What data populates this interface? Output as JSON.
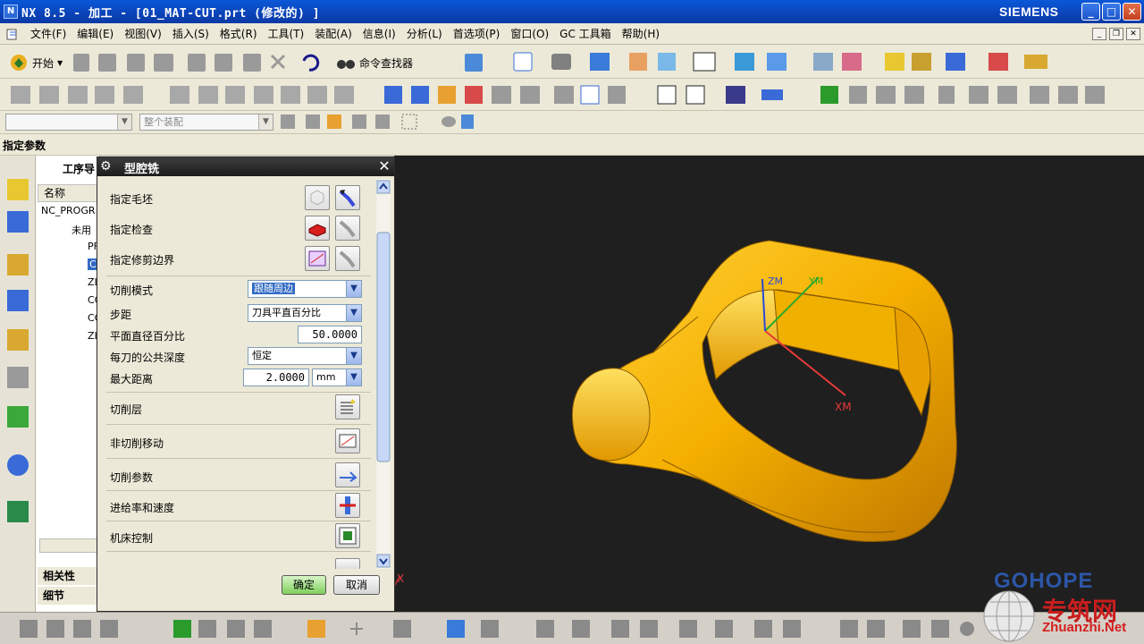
{
  "window": {
    "title": "NX 8.5 - 加工 - [01_MAT-CUT.prt  (修改的) ]",
    "brand": "SIEMENS",
    "min_btn": "_",
    "max_btn": "□",
    "close_btn": "✕"
  },
  "menu": {
    "items": [
      "文件(F)",
      "编辑(E)",
      "视图(V)",
      "插入(S)",
      "格式(R)",
      "工具(T)",
      "装配(A)",
      "信息(I)",
      "分析(L)",
      "首选项(P)",
      "窗口(O)",
      "GC 工具箱",
      "帮助(H)"
    ]
  },
  "toolbar": {
    "start_label": "开始",
    "command_finder_label": "命令查找器",
    "assembly_combo": "整个装配"
  },
  "context": {
    "label": "指定参数"
  },
  "navigator": {
    "title": "工序导",
    "column_name": "名称",
    "root": "NC_PROGR",
    "nodes": [
      "未用",
      "PF",
      "CA",
      "ZL",
      "CC",
      "CC",
      "ZL"
    ],
    "section_dependency": "相关性",
    "section_details": "细节"
  },
  "dialog": {
    "title": "型腔铣",
    "gear": "⚙",
    "close": "✕",
    "rows": {
      "blank_label": "指定毛坯",
      "check_label": "指定检查",
      "trim_label": "指定修剪边界",
      "cut_mode_label": "切削模式",
      "cut_mode_value": "跟随周边",
      "stepover_label": "步距",
      "stepover_value": "刀具平直百分比",
      "flat_diameter_label": "平面直径百分比",
      "flat_diameter_value": "50.0000",
      "common_depth_label": "每刀的公共深度",
      "common_depth_value": "恒定",
      "max_distance_label": "最大距离",
      "max_distance_value": "2.0000",
      "max_distance_unit": "mm",
      "cut_levels_label": "切削层",
      "non_cutting_label": "非切削移动",
      "cutting_params_label": "切削参数",
      "feeds_label": "进给率和速度",
      "machine_control_label": "机床控制"
    },
    "ok_label": "确定",
    "cancel_label": "取消"
  },
  "viewport": {
    "axis_xm": "XM",
    "axis_ym": "YM",
    "axis_zm": "ZM",
    "axis_x": "X",
    "part_color": "#f5b800"
  },
  "watermark": {
    "logo": "GOHOPE",
    "chinese": "专筑网",
    "site": "Zhuanzhi.Net"
  }
}
